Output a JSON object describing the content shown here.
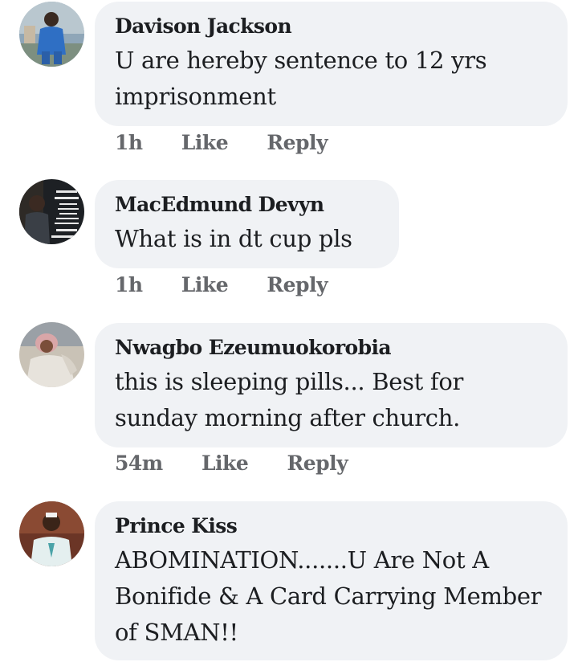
{
  "comments": [
    {
      "author": "Davison Jackson",
      "text": "U are hereby sentence to 12 yrs imprisonment",
      "time": "1h",
      "like_label": "Like",
      "reply_label": "Reply"
    },
    {
      "author": "MacEdmund Devyn",
      "text": "What is in dt cup pls",
      "time": "1h",
      "like_label": "Like",
      "reply_label": "Reply"
    },
    {
      "author": "Nwagbo Ezeumuokorobia",
      "text": "this is sleeping pills...  Best for sunday morning after church.",
      "time": "54m",
      "like_label": "Like",
      "reply_label": "Reply"
    },
    {
      "author": "Prince Kiss",
      "text": "ABOMINATION.......U Are Not A Bonifide & A Card Carrying Member of SMAN!!"
    }
  ],
  "colors": {
    "bubble": "#f0f2f5",
    "text": "#1c1e21",
    "meta": "#65676b"
  }
}
